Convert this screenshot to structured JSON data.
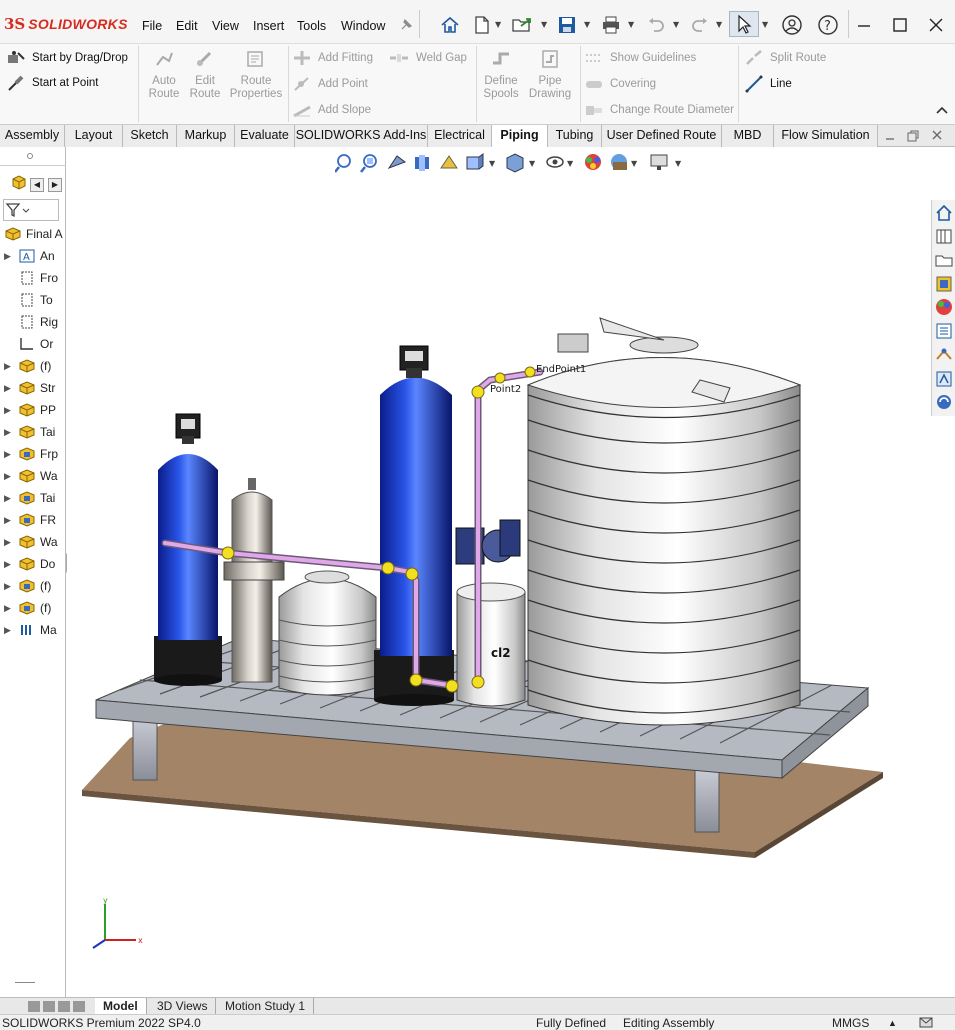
{
  "app": {
    "brand": "SOLIDWORKS",
    "accent_color": "#d62b1e"
  },
  "menu": [
    "File",
    "Edit",
    "View",
    "Insert",
    "Tools",
    "Window"
  ],
  "ribbon": {
    "start_drag_drop": "Start by Drag/Drop",
    "start_at_point": "Start at Point",
    "auto_route": [
      "Auto",
      "Route"
    ],
    "edit_route": [
      "Edit",
      "Route"
    ],
    "route_properties": [
      "Route",
      "Properties"
    ],
    "add_fitting": "Add Fitting",
    "add_point": "Add Point",
    "add_slope": "Add Slope",
    "weld_gap": "Weld Gap",
    "define_spools": [
      "Define",
      "Spools"
    ],
    "pipe_drawing": [
      "Pipe",
      "Drawing"
    ],
    "show_guidelines": "Show Guidelines",
    "covering": "Covering",
    "change_route_diameter": "Change Route Diameter",
    "split_route": "Split Route",
    "line": "Line"
  },
  "tabs": [
    "Assembly",
    "Layout",
    "Sketch",
    "Markup",
    "Evaluate",
    "SOLIDWORKS Add-Ins",
    "Electrical",
    "Piping",
    "Tubing",
    "User Defined Route",
    "MBD",
    "Flow Simulation"
  ],
  "active_tab": "Piping",
  "tree": {
    "root": "Final A",
    "items": [
      {
        "label": "An",
        "icon": "annotations-icon",
        "expandable": true
      },
      {
        "label": "Fro",
        "icon": "plane-icon",
        "expandable": false
      },
      {
        "label": "To",
        "icon": "plane-icon",
        "expandable": false
      },
      {
        "label": "Rig",
        "icon": "plane-icon",
        "expandable": false
      },
      {
        "label": "Or",
        "icon": "origin-icon",
        "expandable": false
      },
      {
        "label": "(f)",
        "icon": "part-icon",
        "expandable": true
      },
      {
        "label": "Str",
        "icon": "part-icon",
        "expandable": true
      },
      {
        "label": "PP",
        "icon": "part-icon",
        "expandable": true
      },
      {
        "label": "Tai",
        "icon": "part-icon",
        "expandable": true
      },
      {
        "label": "Frp",
        "icon": "assembly-icon",
        "expandable": true
      },
      {
        "label": "Wa",
        "icon": "part-icon",
        "expandable": true
      },
      {
        "label": "Tai",
        "icon": "assembly-icon",
        "expandable": true
      },
      {
        "label": "FR",
        "icon": "assembly-icon",
        "expandable": true
      },
      {
        "label": "Wa",
        "icon": "part-icon",
        "expandable": true
      },
      {
        "label": "Do",
        "icon": "part-icon",
        "expandable": true
      },
      {
        "label": "(f)",
        "icon": "assembly-icon",
        "expandable": true
      },
      {
        "label": "(f)",
        "icon": "assembly-icon",
        "expandable": true
      },
      {
        "label": "Ma",
        "icon": "mates-icon",
        "expandable": true
      }
    ]
  },
  "model_labels": {
    "endpoint1": "EndPoint1",
    "point2": "Point2",
    "cl2": "cl2"
  },
  "triad": {
    "x": "x",
    "y": "y"
  },
  "bottom_tabs": [
    "Model",
    "3D Views",
    "Motion Study 1"
  ],
  "active_bottom_tab": "Model",
  "status": {
    "product": "SOLIDWORKS Premium 2022 SP4.0",
    "defined": "Fully Defined",
    "mode": "Editing Assembly",
    "units": "MMGS"
  }
}
